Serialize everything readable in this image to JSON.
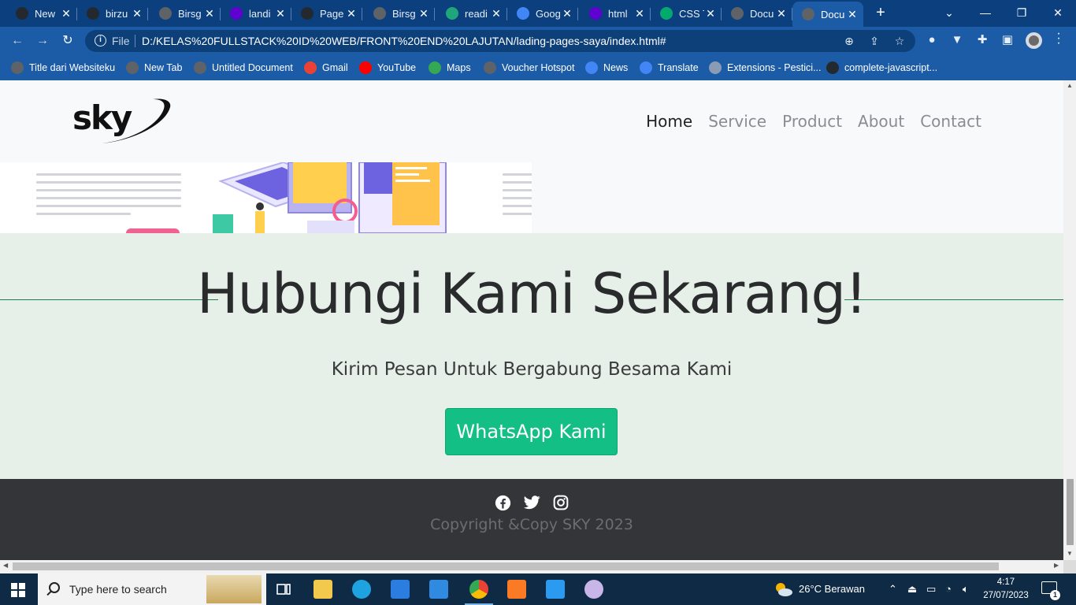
{
  "browser": {
    "tabs": [
      {
        "label": "New",
        "favicon": "github-icon",
        "color": "#24292f"
      },
      {
        "label": "birzu",
        "favicon": "github-icon",
        "color": "#24292f"
      },
      {
        "label": "Birsg",
        "favicon": "globe-icon",
        "color": "#5f6368"
      },
      {
        "label": "landi",
        "favicon": "yahoo-icon",
        "color": "#6001d2"
      },
      {
        "label": "Page",
        "favicon": "github-icon",
        "color": "#24292f"
      },
      {
        "label": "Birsg",
        "favicon": "globe-icon",
        "color": "#5f6368"
      },
      {
        "label": "readi",
        "favicon": "notebook-icon",
        "color": "#1fa67a"
      },
      {
        "label": "Goog",
        "favicon": "google-translate-icon",
        "color": "#4285f4"
      },
      {
        "label": "html",
        "favicon": "yahoo-icon",
        "color": "#6001d2"
      },
      {
        "label": "CSS T",
        "favicon": "w3schools-icon",
        "color": "#04aa6d"
      },
      {
        "label": "Docu",
        "favicon": "globe-icon",
        "color": "#5f6368"
      },
      {
        "label": "Docu",
        "favicon": "globe-icon",
        "color": "#5f6368",
        "active": true
      }
    ],
    "file_label": "File",
    "url": "D:/KELAS%20FULLSTACK%20ID%20WEB/FRONT%20END%20LAJUTAN/lading-pages-saya/index.html#",
    "bookmarks": [
      {
        "label": "Title dari Websiteku",
        "icon": "globe-icon",
        "color": "#5f6368"
      },
      {
        "label": "New Tab",
        "icon": "globe-icon",
        "color": "#5f6368"
      },
      {
        "label": "Untitled Document",
        "icon": "globe-icon",
        "color": "#5f6368"
      },
      {
        "label": "Gmail",
        "icon": "gmail-icon",
        "color": "#ea4335"
      },
      {
        "label": "YouTube",
        "icon": "youtube-icon",
        "color": "#ff0000"
      },
      {
        "label": "Maps",
        "icon": "maps-icon",
        "color": "#34a853"
      },
      {
        "label": "Voucher Hotspot",
        "icon": "globe-icon",
        "color": "#5f6368"
      },
      {
        "label": "News",
        "icon": "google-news-icon",
        "color": "#4285f4"
      },
      {
        "label": "Translate",
        "icon": "google-translate-icon",
        "color": "#4285f4"
      },
      {
        "label": "Extensions - Pestici...",
        "icon": "puzzle-icon",
        "color": "#8a9bb5"
      },
      {
        "label": "complete-javascript...",
        "icon": "github-icon",
        "color": "#24292f"
      }
    ]
  },
  "page": {
    "nav": {
      "logo_text": "sky",
      "links": [
        {
          "label": "Home",
          "active": true
        },
        {
          "label": "Service"
        },
        {
          "label": "Product"
        },
        {
          "label": "About"
        },
        {
          "label": "Contact"
        }
      ]
    },
    "contact": {
      "heading": "Hubungi Kami Sekarang!",
      "subtext": "Kirim Pesan Untuk Bergabung Besama Kami",
      "button": "WhatsApp Kami",
      "bg_color": "#e6f0e8",
      "button_color": "#14bf85"
    },
    "footer": {
      "socials": [
        "facebook-icon",
        "twitter-icon",
        "instagram-icon"
      ],
      "copyright": "Copyright &Copy SKY 2023",
      "bg_color": "#333539"
    }
  },
  "taskbar": {
    "search_placeholder": "Type here to search",
    "weather": "26°C  Berawan",
    "time": "4:17",
    "date": "27/07/2023",
    "notifications": "1",
    "apps": [
      "task-view-icon",
      "file-explorer-icon",
      "edge-icon",
      "store-icon",
      "mail-icon",
      "chrome-icon",
      "xampp-icon",
      "vscode-icon",
      "paint-icon"
    ]
  }
}
